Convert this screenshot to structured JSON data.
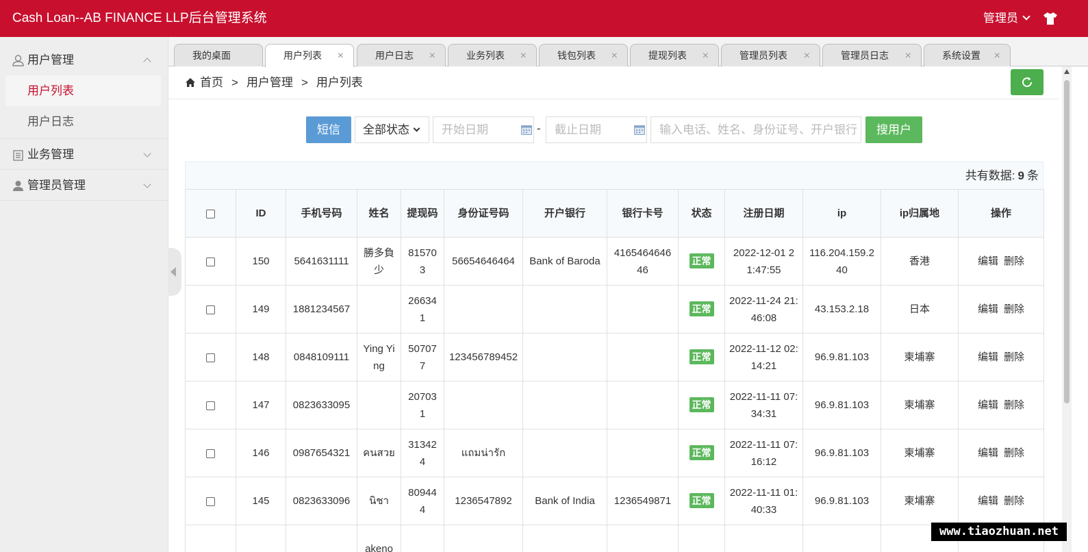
{
  "header": {
    "title": "Cash Loan--AB FINANCE LLP后台管理系统",
    "admin_label": "管理员"
  },
  "sidebar": {
    "groups": [
      {
        "label": "用户管理",
        "icon": "user-icon",
        "expanded": true,
        "items": [
          {
            "label": "用户列表",
            "active": true
          },
          {
            "label": "用户日志",
            "active": false
          }
        ]
      },
      {
        "label": "业务管理",
        "icon": "document-icon",
        "expanded": false
      },
      {
        "label": "管理员管理",
        "icon": "admin-user-icon",
        "expanded": false
      }
    ]
  },
  "tabs": [
    {
      "label": "我的桌面",
      "closable": false
    },
    {
      "label": "用户列表",
      "closable": true,
      "active": true
    },
    {
      "label": "用户日志",
      "closable": true
    },
    {
      "label": "业务列表",
      "closable": true
    },
    {
      "label": "钱包列表",
      "closable": true
    },
    {
      "label": "提现列表",
      "closable": true
    },
    {
      "label": "管理员列表",
      "closable": true
    },
    {
      "label": "管理员日志",
      "closable": true
    },
    {
      "label": "系统设置",
      "closable": true
    }
  ],
  "tab_close_glyph": "×",
  "breadcrumb": {
    "items": [
      "首页",
      "用户管理",
      "用户列表"
    ],
    "separator": ">"
  },
  "search": {
    "sms_label": "短信",
    "status_value": "全部状态",
    "start_date_placeholder": "开始日期",
    "date_dash": "-",
    "end_date_placeholder": "截止日期",
    "keyword_placeholder": "输入电话、姓名、身份证号、开户银行",
    "search_label": "搜用户"
  },
  "summary": {
    "prefix": "共有数据:",
    "count": "9",
    "suffix": "条"
  },
  "table": {
    "columns": [
      "ID",
      "手机号码",
      "姓名",
      "提现码",
      "身份证号码",
      "开户银行",
      "银行卡号",
      "状态",
      "注册日期",
      "ip",
      "ip归属地",
      "操作"
    ],
    "rows": [
      {
        "id": "150",
        "phone": "5641631111",
        "name": "勝多負少",
        "code": "815703",
        "idcard": "56654646464",
        "bank": "Bank of Baroda",
        "card": "416546464646",
        "status": "正常",
        "date": "2022-12-01 21:47:55",
        "ip": "116.204.159.240",
        "region": "香港"
      },
      {
        "id": "149",
        "phone": "1881234567",
        "name": "",
        "code": "266341",
        "idcard": "",
        "bank": "",
        "card": "",
        "status": "正常",
        "date": "2022-11-24 21:46:08",
        "ip": "43.153.2.18",
        "region": "日本"
      },
      {
        "id": "148",
        "phone": "0848109111",
        "name": "Ying Ying",
        "code": "507077",
        "idcard": "123456789452",
        "bank": "",
        "card": "",
        "status": "正常",
        "date": "2022-11-12 02:14:21",
        "ip": "96.9.81.103",
        "region": "柬埔寨"
      },
      {
        "id": "147",
        "phone": "0823633095",
        "name": "",
        "code": "207031",
        "idcard": "",
        "bank": "",
        "card": "",
        "status": "正常",
        "date": "2022-11-11 07:34:31",
        "ip": "96.9.81.103",
        "region": "柬埔寨"
      },
      {
        "id": "146",
        "phone": "0987654321",
        "name": "คนสวย",
        "code": "313424",
        "idcard": "แถมน่ารัก",
        "bank": "",
        "card": "",
        "status": "正常",
        "date": "2022-11-11 07:16:12",
        "ip": "96.9.81.103",
        "region": "柬埔寨"
      },
      {
        "id": "145",
        "phone": "0823633096",
        "name": "นิชา",
        "code": "809444",
        "idcard": "1236547892",
        "bank": "Bank of India",
        "card": "1236549871",
        "status": "正常",
        "date": "2022-11-11 01:40:33",
        "ip": "96.9.81.103",
        "region": "柬埔寨"
      },
      {
        "id": "",
        "phone": "",
        "name": "akeno",
        "code": "",
        "idcard": "",
        "bank": "",
        "card": "",
        "status": "",
        "date": "",
        "ip": "",
        "region": ""
      }
    ],
    "actions": {
      "edit": "编辑",
      "delete": "删除"
    }
  },
  "watermark": "www.tiaozhuan.net",
  "colors": {
    "brand_red": "#c8102e",
    "success_green": "#5cb85c",
    "sms_blue": "#5b9bd5",
    "active_menu": "#c8102e"
  }
}
